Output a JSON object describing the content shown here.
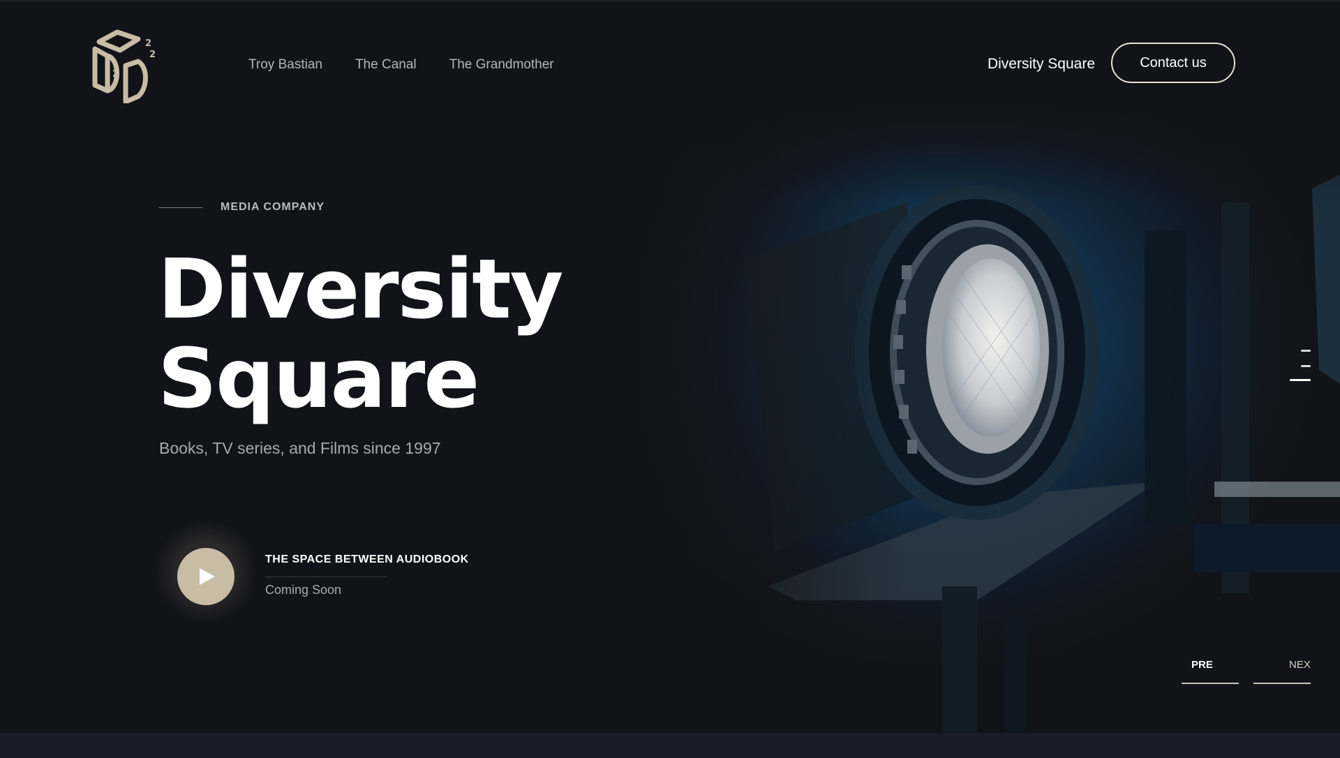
{
  "header": {
    "nav_items": [
      "Troy Bastian",
      "The Canal",
      "The Grandmother"
    ],
    "site_link": "Diversity Square",
    "contact_label": "Contact us"
  },
  "hero": {
    "eyebrow": "MEDIA COMPANY",
    "title_line1": "Diversity",
    "title_line2": "Square",
    "subtitle": "Books, TV series, and Films since 1997"
  },
  "audio": {
    "title": "THE SPACE BETWEEN AUDIOBOOK",
    "status": "Coming Soon"
  },
  "slider": {
    "prev_label": "PRE",
    "next_label": "NEX",
    "slide_count": 3,
    "active_slide": 3
  },
  "colors": {
    "background": "#121318",
    "accent": "#c8bca5",
    "spotlight": "#1d6fae"
  },
  "icons": {
    "logo": "cube-d-logo-icon",
    "play": "play-icon"
  }
}
